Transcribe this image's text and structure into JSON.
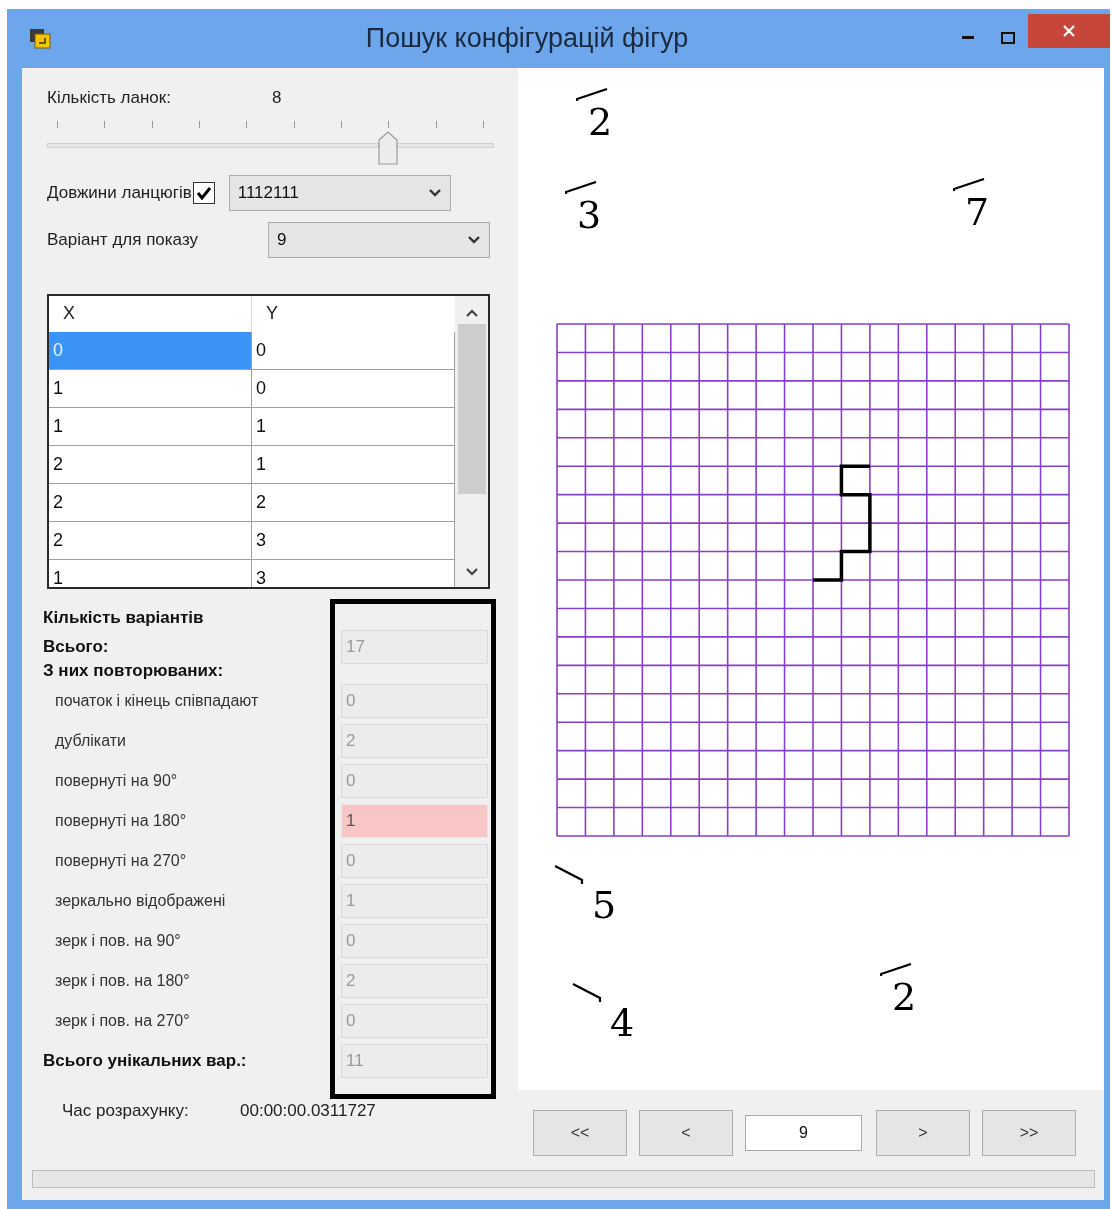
{
  "window": {
    "title": "Пошук конфігурацій фігур"
  },
  "links": {
    "label": "Кількість ланок:",
    "value": "8",
    "slider": {
      "level": 0.778
    }
  },
  "chain_lengths": {
    "label": "Довжини ланцюгів",
    "checked": true,
    "value": "1112111"
  },
  "variant": {
    "label": "Варіант для показу",
    "value": "9"
  },
  "table": {
    "columns": [
      "X",
      "Y"
    ],
    "rows": [
      {
        "cells": [
          "0",
          "0"
        ],
        "selected": true
      },
      {
        "cells": [
          "1",
          "0"
        ],
        "selected": false
      },
      {
        "cells": [
          "1",
          "1"
        ],
        "selected": false
      },
      {
        "cells": [
          "2",
          "1"
        ],
        "selected": false
      },
      {
        "cells": [
          "2",
          "2"
        ],
        "selected": false
      },
      {
        "cells": [
          "2",
          "3"
        ],
        "selected": false
      },
      {
        "cells": [
          "1",
          "3"
        ],
        "selected": false
      }
    ]
  },
  "stats": {
    "heading": "Кількість варіантів",
    "total_label": "Всього:",
    "total": "17",
    "repeated_heading": "З них повторюваних:",
    "items": [
      {
        "label": "початок і кінець співпадают",
        "value": "0",
        "highlighted": false
      },
      {
        "label": "дублікати",
        "value": "2",
        "highlighted": false
      },
      {
        "label": "повернуті на 90°",
        "value": "0",
        "highlighted": false
      },
      {
        "label": "повернуті на 180°",
        "value": "1",
        "highlighted": true
      },
      {
        "label": "повернуті на 270°",
        "value": "0",
        "highlighted": false
      },
      {
        "label": "зеркально відображені",
        "value": "1",
        "highlighted": false
      },
      {
        "label": "зерк і пов. на 90°",
        "value": "0",
        "highlighted": false
      },
      {
        "label": "зерк і пов. на 180°",
        "value": "2",
        "highlighted": false
      },
      {
        "label": "зерк і пов. на 270°",
        "value": "0",
        "highlighted": false
      }
    ],
    "unique_label": "Всього унікальних вар.:",
    "unique": "11",
    "disabled": true
  },
  "time": {
    "label": "Час розрахунку:",
    "value": "00:00:00.0311727"
  },
  "annotations": [
    {
      "text": "2",
      "kind": "rising"
    },
    {
      "text": "3",
      "kind": "rising"
    },
    {
      "text": "7",
      "kind": "rising"
    },
    {
      "text": "5",
      "kind": "falling"
    },
    {
      "text": "4",
      "kind": "falling"
    },
    {
      "text": "2",
      "kind": "rising"
    }
  ],
  "navigation": {
    "first": "<<",
    "prev": "<",
    "page": "9",
    "next": ">",
    "last": ">>"
  }
}
